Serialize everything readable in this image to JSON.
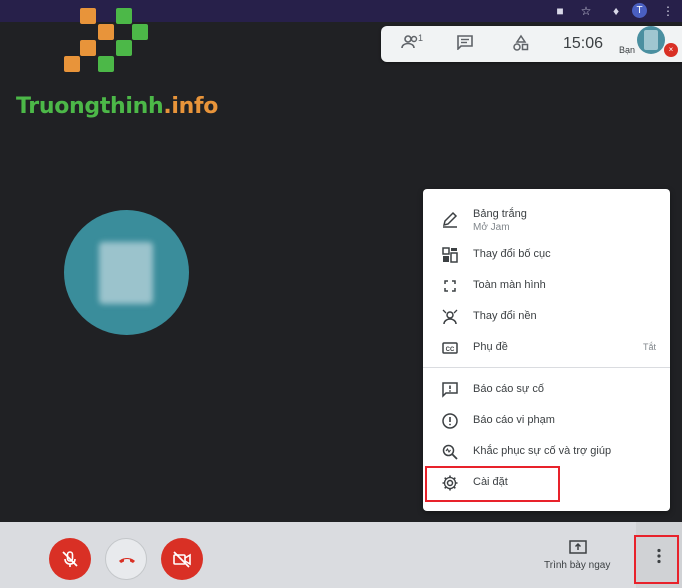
{
  "browser": {
    "profile_initial": "T"
  },
  "watermark": {
    "brand_main": "Truongthinh",
    "brand_suffix": ".info"
  },
  "info_panel": {
    "people_count": "1",
    "time": "15:06",
    "self_label": "Bạn",
    "icons": [
      "people-icon",
      "chat-icon",
      "activities-icon"
    ]
  },
  "menu": {
    "items": [
      {
        "label": "Bảng trắng",
        "sub": "Mở Jam",
        "icon": "pen-icon"
      },
      {
        "label": "Thay đổi bố cục",
        "icon": "layout-icon"
      },
      {
        "label": "Toàn màn hình",
        "icon": "fullscreen-icon"
      },
      {
        "label": "Thay đổi nền",
        "icon": "background-icon"
      },
      {
        "label": "Phụ đề",
        "shortcut": "Tắt",
        "icon": "captions-icon"
      },
      {
        "label": "Báo cáo sự cố",
        "icon": "report-problem-icon"
      },
      {
        "label": "Báo cáo vi phạm",
        "icon": "report-abuse-icon"
      },
      {
        "label": "Khắc phục sự cố và trợ giúp",
        "icon": "troubleshoot-icon"
      },
      {
        "label": "Cài đặt",
        "icon": "settings-icon"
      }
    ]
  },
  "controls": {
    "present_label": "Trình bày ngay"
  },
  "colors": {
    "highlight": "#e8222b",
    "danger": "#d93025",
    "avatar": "#3a8d9b"
  }
}
